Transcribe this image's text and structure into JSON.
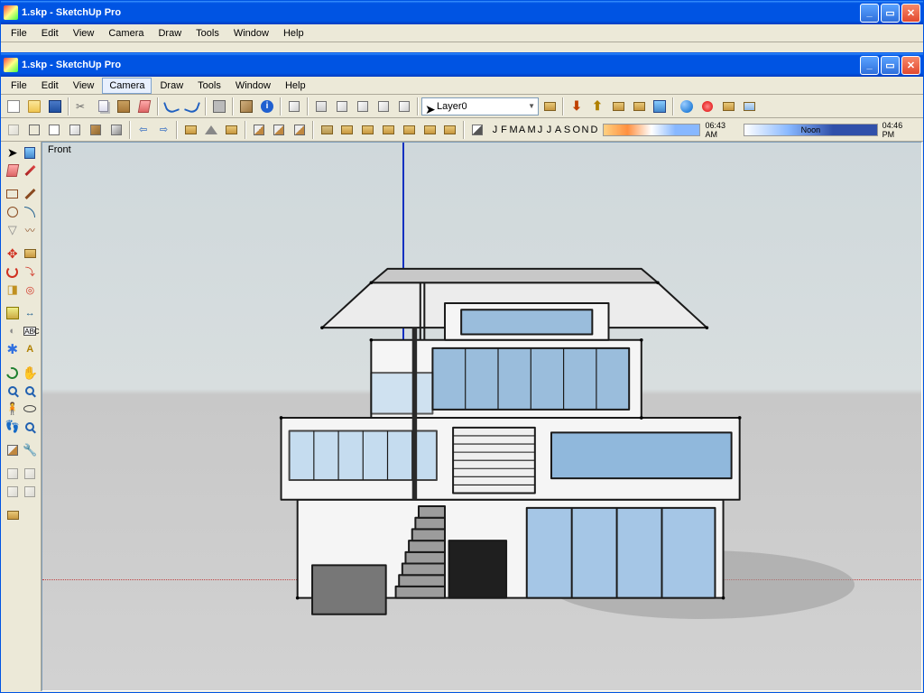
{
  "app_title": "1.skp - SketchUp Pro",
  "menubar": [
    "File",
    "Edit",
    "View",
    "Camera",
    "Draw",
    "Tools",
    "Window",
    "Help"
  ],
  "layer": "Layer0",
  "view_label": "Front",
  "months": [
    "J",
    "F",
    "M",
    "A",
    "M",
    "J",
    "J",
    "A",
    "S",
    "O",
    "N",
    "D"
  ],
  "time1": "06:43 AM",
  "time2": "Noon",
  "time3": "04:46 PM"
}
